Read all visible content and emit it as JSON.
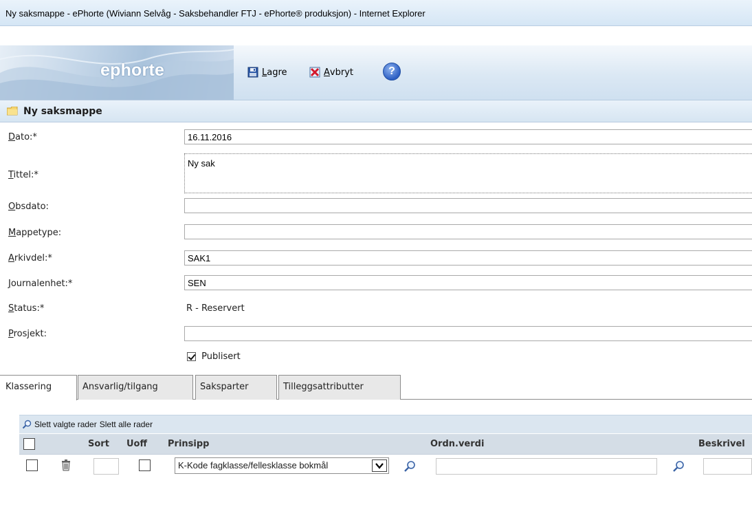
{
  "window": {
    "title": "Ny saksmappe - ePhorte (Wiviann Selvåg - Saksbehandler FTJ - ePhorte® produksjon) - Internet Explorer"
  },
  "header": {
    "logo": "ephorte",
    "save_label_first": "L",
    "save_label_rest": "agre",
    "cancel_label_first": "A",
    "cancel_label_rest": "vbryt",
    "help_label": "?"
  },
  "section": {
    "title": "Ny saksmappe"
  },
  "form": {
    "dato": {
      "label_first": "D",
      "label_rest": "ato:*",
      "value": "16.11.2016"
    },
    "tittel": {
      "label_first": "T",
      "label_rest": "ittel:*",
      "value": "Ny sak"
    },
    "obsdato": {
      "label_first": "O",
      "label_rest": "bsdato:",
      "value": ""
    },
    "mappetype": {
      "label_first": "M",
      "label_rest": "appetype:",
      "value": ""
    },
    "arkivdel": {
      "label_first": "A",
      "label_rest": "rkivdel:*",
      "value": "SAK1"
    },
    "journalenhet": {
      "label_first": "J",
      "label_rest": "ournalenhet:*",
      "value": "SEN"
    },
    "status": {
      "label_first": "S",
      "label_rest": "tatus:*",
      "value": "R - Reservert"
    },
    "prosjekt": {
      "label_first": "P",
      "label_rest": "rosjekt:",
      "value": ""
    },
    "publisert": {
      "label": "Publisert",
      "checked": true
    }
  },
  "tabs": [
    "Klassering",
    "Ansvarlig/tilgang",
    "Saksparter",
    "Tilleggsattributter"
  ],
  "grid": {
    "toolbar": {
      "delete_selected": "Slett valgte rader",
      "delete_all": "Slett alle rader"
    },
    "columns": {
      "sort": "Sort",
      "uoff": "Uoff",
      "prinsipp": "Prinsipp",
      "ordnverdi": "Ordn.verdi",
      "beskrivelse": "Beskrivel"
    },
    "row": {
      "prinsipp_selected": "K-Kode fagklasse/fellesklasse bokmål",
      "ordnverdi": "",
      "beskrivelse": ""
    }
  },
  "colors": {
    "accent": "#d5e6f5",
    "header_bg": "#dbe8f4",
    "grid_header": "#d4dde6"
  }
}
